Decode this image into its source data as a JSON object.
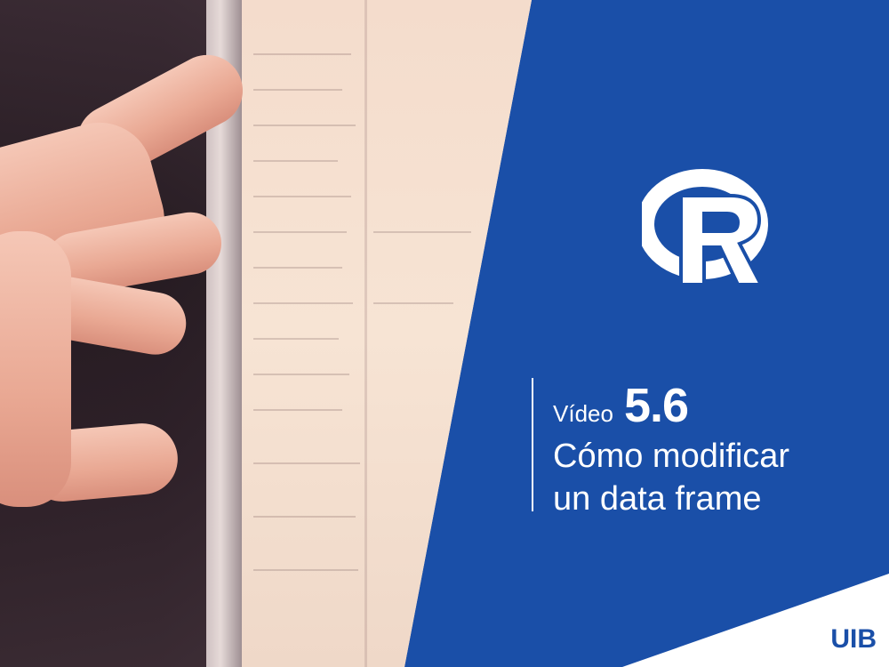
{
  "logo": {
    "icon": "r-logo-icon",
    "color": "#ffffff"
  },
  "title": {
    "prefix": "Vídeo",
    "number": "5.6",
    "line1": "Cómo modificar",
    "line2": "un data frame"
  },
  "brand": {
    "label": "UIB",
    "color": "#1a4fa8"
  },
  "colors": {
    "panel": "#1a4fa8",
    "text": "#ffffff",
    "corner": "#ffffff"
  }
}
